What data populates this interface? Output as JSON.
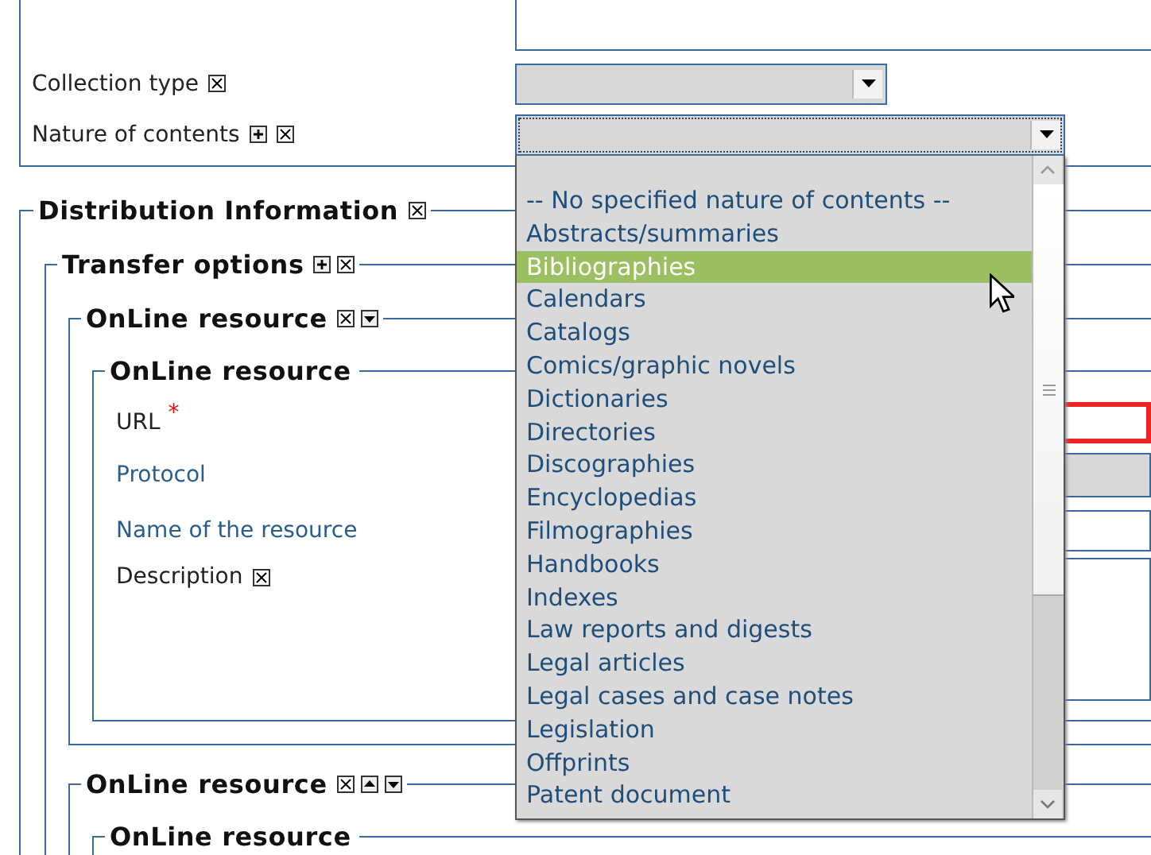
{
  "top_section": {
    "fields": [
      {
        "label": "Collection type",
        "add": false,
        "remove": true,
        "expanded": false
      },
      {
        "label": "Nature of contents",
        "add": true,
        "remove": true,
        "expanded": true
      }
    ]
  },
  "distribution": {
    "title": "Distribution Information",
    "remove": true,
    "transfer_options": {
      "title": "Transfer options",
      "add": true,
      "remove": true,
      "online_resources": [
        {
          "title": "OnLine resource",
          "remove": true,
          "move_up": false,
          "move_down": true,
          "inner": {
            "title": "OnLine resource",
            "fields": [
              {
                "label": "URL",
                "link": false,
                "required_mark": "*",
                "kind": "text",
                "invalid": true,
                "remove": false
              },
              {
                "label": "Protocol",
                "link": true,
                "kind": "select",
                "invalid": false,
                "remove": false
              },
              {
                "label": "Name of the resource",
                "link": true,
                "kind": "text",
                "invalid": false,
                "remove": false
              },
              {
                "label": "Description",
                "link": false,
                "kind": "textarea",
                "invalid": false,
                "remove": true
              }
            ]
          }
        },
        {
          "title": "OnLine resource",
          "remove": true,
          "move_up": true,
          "move_down": true,
          "inner": {
            "title": "OnLine resource"
          }
        }
      ]
    }
  },
  "dropdown": {
    "options": [
      {
        "label": "-- No specified nature of contents --",
        "selected": false
      },
      {
        "label": "Abstracts/summaries",
        "selected": false
      },
      {
        "label": "Bibliographies",
        "selected": true
      },
      {
        "label": "Calendars",
        "selected": false
      },
      {
        "label": "Catalogs",
        "selected": false
      },
      {
        "label": "Comics/graphic novels",
        "selected": false
      },
      {
        "label": "Dictionaries",
        "selected": false
      },
      {
        "label": "Directories",
        "selected": false
      },
      {
        "label": "Discographies",
        "selected": false
      },
      {
        "label": "Encyclopedias",
        "selected": false
      },
      {
        "label": "Filmographies",
        "selected": false
      },
      {
        "label": "Handbooks",
        "selected": false
      },
      {
        "label": "Indexes",
        "selected": false
      },
      {
        "label": "Law reports and digests",
        "selected": false
      },
      {
        "label": "Legal articles",
        "selected": false
      },
      {
        "label": "Legal cases and case notes",
        "selected": false
      },
      {
        "label": "Legislation",
        "selected": false
      },
      {
        "label": "Offprints",
        "selected": false
      },
      {
        "label": "Patent document",
        "selected": false
      }
    ]
  }
}
